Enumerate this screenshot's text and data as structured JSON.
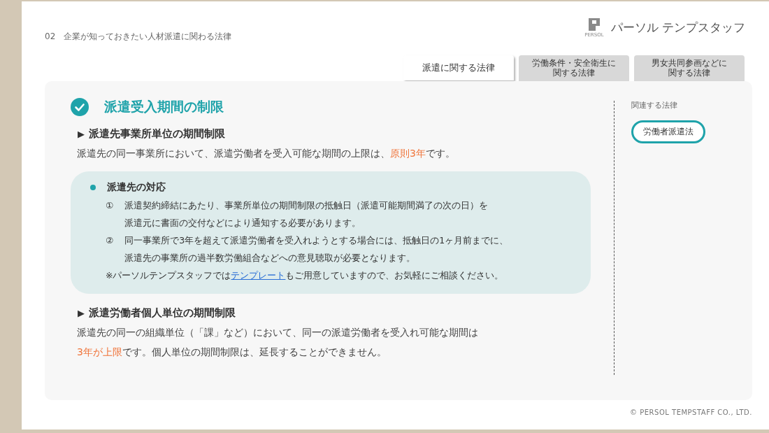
{
  "header": {
    "breadcrumb": "02　企業が知っておきたい人材派遣に関わる法律",
    "logo_small": "PERSOL",
    "logo_text": "パーソル テンプスタッフ"
  },
  "tabs": [
    {
      "label_lines": [
        "派遣に関する法律"
      ],
      "selected": true
    },
    {
      "label_lines": [
        "労働条件・安全衛生に",
        "関する法律"
      ],
      "selected": false
    },
    {
      "label_lines": [
        "男女共同参画などに",
        "関する法律"
      ],
      "selected": false
    }
  ],
  "section": {
    "title": "派遣受入期間の制限",
    "blocks": [
      {
        "marker": "▶",
        "heading": "派遣先事業所単位の期間制限",
        "lines": [
          [
            {
              "text": "派遣先の同一事業所において、派遣労働者を受入可能な期間の上限は、",
              "kind": "plain"
            },
            {
              "text": "原則3年",
              "kind": "highlight"
            },
            {
              "text": "です。",
              "kind": "plain"
            }
          ]
        ],
        "note": {
          "bullet_title": "派遣先の対応",
          "items": [
            {
              "number": "①",
              "lines": [
                "派遣契約締結にあたり、事業所単位の期間制限の抵触日（派遣可能期間満了の次の日）を",
                "派遣元に書面の交付などにより通知する必要があります。"
              ]
            },
            {
              "number": "②",
              "lines": [
                "同一事業所で3年を超えて派遣労働者を受入れようとする場合には、抵触日の1ヶ月前までに、",
                "派遣先の事業所の過半数労働組合などへの意見聴取が必要となります。"
              ]
            }
          ],
          "footnote": [
            {
              "text": "※パーソルテンプスタッフでは",
              "kind": "plain"
            },
            {
              "text": "テンプレート",
              "kind": "link"
            },
            {
              "text": "もご用意していますので、お気軽にご相談ください。",
              "kind": "plain"
            }
          ]
        }
      },
      {
        "marker": "▶",
        "heading": "派遣労働者個人単位の期間制限",
        "lines": [
          [
            {
              "text": "派遣先の同一の組織単位（「課」など）において、同一の派遣労働者を受入れ可能な期間は",
              "kind": "plain"
            }
          ],
          [
            {
              "text": "3年が上限",
              "kind": "highlight"
            },
            {
              "text": "です。個人単位の期間制限は、延長することができません。",
              "kind": "plain"
            }
          ]
        ]
      }
    ]
  },
  "related": {
    "label": "関連する法律",
    "items": [
      "労働者派遣法"
    ]
  },
  "copyright": "© PERSOL TEMPSTAFF CO., LTD."
}
